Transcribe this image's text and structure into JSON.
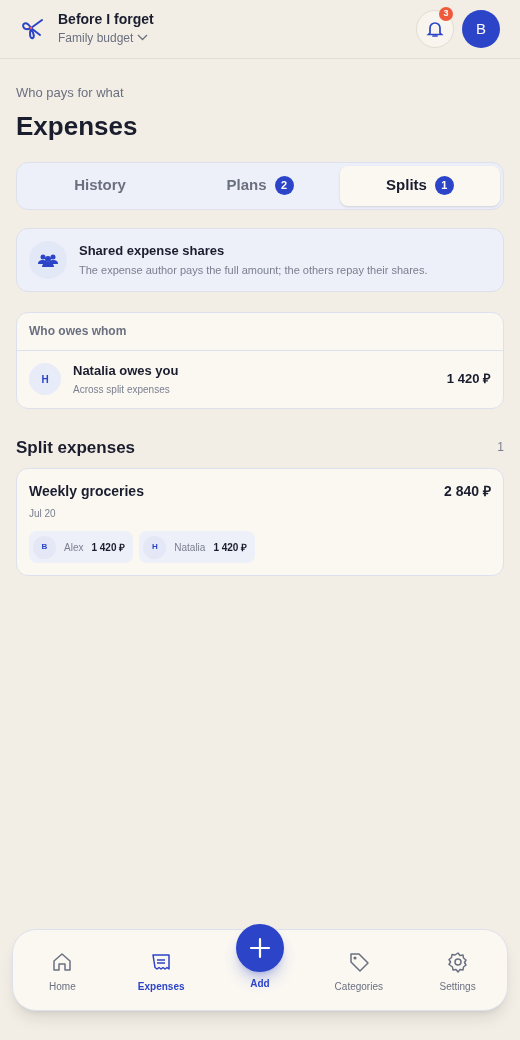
{
  "header": {
    "app_name": "Before I forget",
    "budget": "Family budget",
    "notifications": "3",
    "avatar": "B"
  },
  "page": {
    "subtitle": "Who pays for what",
    "title": "Expenses"
  },
  "tabs": [
    {
      "label": "History",
      "selected": false
    },
    {
      "label": "Plans",
      "badge": "2",
      "selected": false
    },
    {
      "label": "Splits",
      "badge": "1",
      "selected": true
    }
  ],
  "info": {
    "title": "Shared expense shares",
    "text": "The expense author pays the full amount; the others repay their shares."
  },
  "balances": {
    "title": "Who owes whom",
    "rows": [
      {
        "avatar": "Н",
        "title": "Natalia owes you",
        "subtitle": "Across split expenses",
        "amount": "1 420 ₽"
      }
    ]
  },
  "split_expenses": {
    "title": "Split expenses",
    "count": "1",
    "items": [
      {
        "title": "Weekly groceries",
        "date": "Jul 20",
        "amount": "2 840 ₽",
        "shares": [
          {
            "avatar": "В",
            "name": "Alex",
            "amount": "1 420 ₽"
          },
          {
            "avatar": "Н",
            "name": "Natalia",
            "amount": "1 420 ₽"
          }
        ]
      }
    ]
  },
  "nav": [
    {
      "kind": "home",
      "label": "Home",
      "selected": false
    },
    {
      "kind": "expenses",
      "label": "Expenses",
      "selected": true
    },
    {
      "kind": "add",
      "label": "Add"
    },
    {
      "kind": "categories",
      "label": "Categories",
      "selected": false
    },
    {
      "kind": "settings",
      "label": "Settings",
      "selected": false
    }
  ]
}
